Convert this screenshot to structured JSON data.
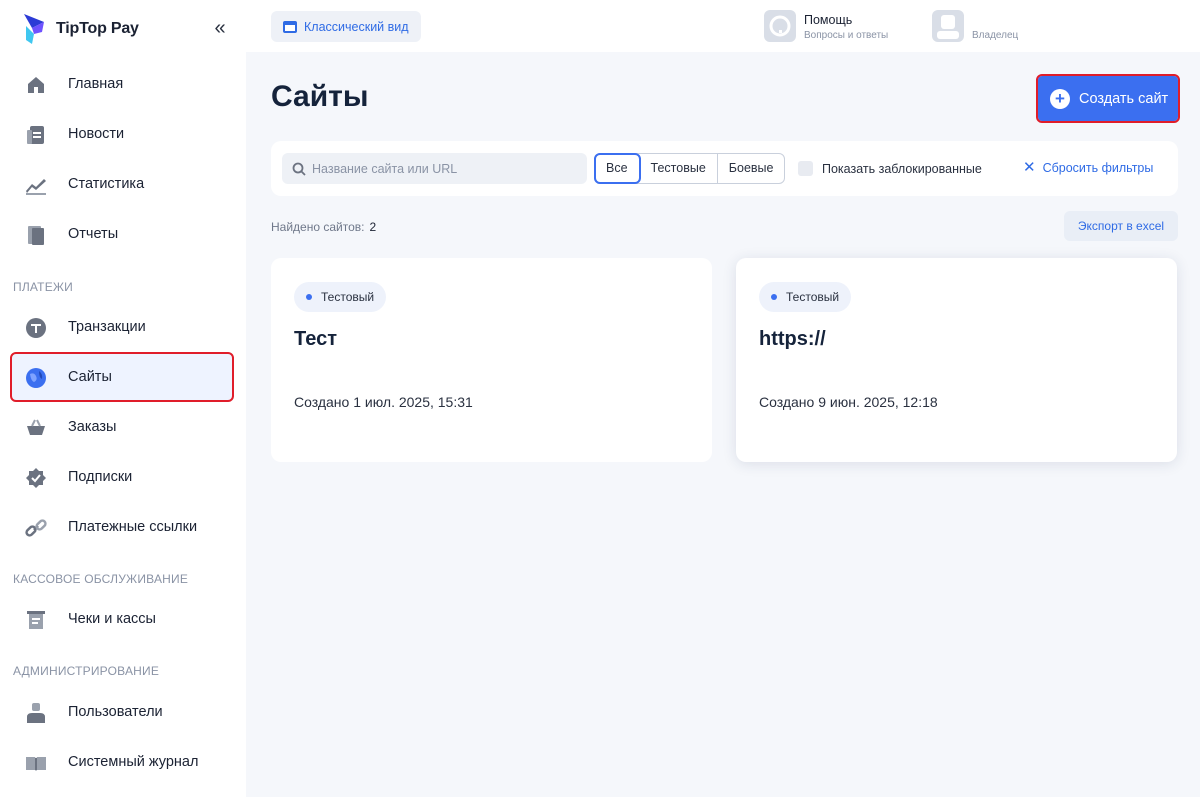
{
  "brand": {
    "name": "TipTop Pay",
    "collapse_glyph": "«"
  },
  "topbar": {
    "classic_view": "Классический вид",
    "help_title": "Помощь",
    "help_subtitle": "Вопросы и ответы",
    "owner_label": "Владелец"
  },
  "sidebar": {
    "items_main": [
      {
        "label": "Главная",
        "icon": "home-icon"
      },
      {
        "label": "Новости",
        "icon": "news-icon"
      },
      {
        "label": "Статистика",
        "icon": "chart-icon"
      },
      {
        "label": "Отчеты",
        "icon": "reports-icon"
      }
    ],
    "section_payments": "ПЛАТЕЖИ",
    "items_payments": [
      {
        "label": "Транзакции",
        "icon": "transactions-icon"
      },
      {
        "label": "Сайты",
        "icon": "globe-icon",
        "active": true
      },
      {
        "label": "Заказы",
        "icon": "basket-icon"
      },
      {
        "label": "Подписки",
        "icon": "subscription-icon"
      },
      {
        "label": "Платежные ссылки",
        "icon": "link-icon"
      }
    ],
    "section_cash": "КАССОВОЕ ОБСЛУЖИВАНИЕ",
    "items_cash": [
      {
        "label": "Чеки и кассы",
        "icon": "receipt-icon"
      }
    ],
    "section_admin": "АДМИНИСТРИРОВАНИЕ",
    "items_admin": [
      {
        "label": "Пользователи",
        "icon": "user-icon"
      },
      {
        "label": "Системный журнал",
        "icon": "book-icon"
      }
    ]
  },
  "main": {
    "title": "Сайты",
    "create_button": "Создать сайт",
    "search_placeholder": "Название сайта или URL",
    "segments": [
      "Все",
      "Тестовые",
      "Боевые"
    ],
    "selected_segment": "Все",
    "show_blocked": "Показать заблокированные",
    "reset_filters": "Сбросить фильтры",
    "found_label": "Найдено сайтов:",
    "found_count": "2",
    "export": "Экспорт в excel",
    "cards": [
      {
        "badge": "Тестовый",
        "name": "Тест",
        "created": "Создано 1 июл. 2025, 15:31"
      },
      {
        "badge": "Тестовый",
        "name": "https://",
        "created": "Создано 9 июн. 2025, 12:18"
      }
    ]
  },
  "colors": {
    "accent": "#3b6ff0",
    "link": "#2f6be5",
    "highlight_outline": "#e01d2a",
    "background": "#f5f7fb"
  }
}
